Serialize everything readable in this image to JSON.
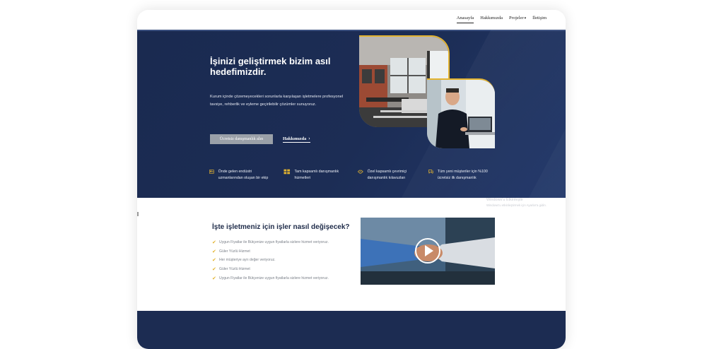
{
  "nav": {
    "items": [
      "Anasayfa",
      "Hakkımızda",
      "Projeler",
      "İletişim"
    ],
    "active": "Anasayfa",
    "dropdown_caret": "▾"
  },
  "hero": {
    "title": "İşinizi geliştirmek bizim asıl hedefimizdir.",
    "description": "Kurum içinde çözemeyecekleri sorunlarla karşılaşan işletmelere profesyonel tavsiye, rehberlik ve eyleme geçirilebilir çözümler sunuyoruz.",
    "primary_button": "Ücretsiz danışmanlık alın",
    "secondary_link": "Hakkımızda",
    "secondary_link_arrow": "›",
    "features": [
      {
        "icon": "id-card-icon",
        "text": "Önde gelen endüstri uzmanlarından oluşan bir ekip"
      },
      {
        "icon": "grid-icon",
        "text": "Tam kapsamlı danışmanlık hizmetleri"
      },
      {
        "icon": "handshake-icon",
        "text": "Özel kapsamlı çevrimiçi danışmanlık kılavuzları"
      },
      {
        "icon": "chat-icon",
        "text": "Tüm yeni müşteriler için %100 ücretsiz ilk danışmanlık"
      }
    ]
  },
  "watermark": {
    "line1": "Windows'u Etkinleştir",
    "line2": "Windows'u etkinleştirmek için Ayarlar'a gidin."
  },
  "section2": {
    "title": "İşte işletmeniz için işler nasıl değişecek?",
    "items": [
      "Uygun Fiyatlar ile Bütçenize uygun fiyatlarla sizlere hizmet veriyoruz.",
      "Güler Yüzlü Hizmet",
      "Her müşteriye ayrı değer veriyoruz.",
      "Güler Yüzlü Hizmet",
      "Uygun Fiyatlar ile Bütçenize uygun fiyatlarla sizlere hizmet veriyoruz."
    ],
    "check_glyph": "✔"
  },
  "colors": {
    "hero_bg": "#1c2d55",
    "accent": "#e3b32f",
    "button_bg": "#9aa0a8",
    "title_dark": "#1d2a48"
  }
}
